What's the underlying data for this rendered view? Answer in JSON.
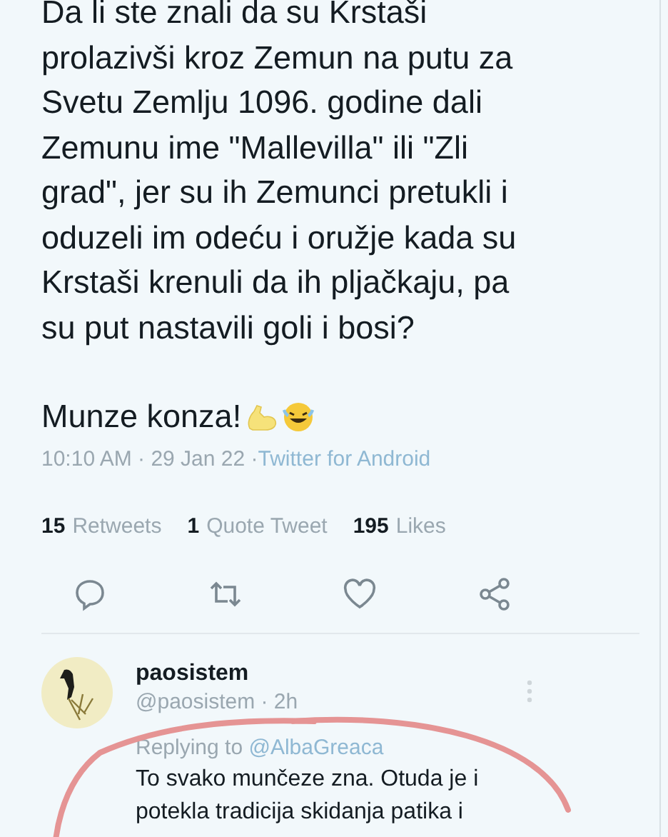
{
  "tweet": {
    "text_lines": [
      "Da li ste znali da su Krstaši",
      "prolazivši kroz Zemun na putu za",
      "Svetu Zemlju 1096. godine dali",
      "Zemunu ime \"Mallevilla\" ili \"Zli",
      "grad\", jer su ih Zemunci pretukli i",
      "oduzeli im odeću i oružje kada su",
      "Krstaši krenuli da ih pljačkaju, pa",
      "su put nastavili goli i bosi?"
    ],
    "closing": "Munze konza!",
    "time": "10:10 AM · 29 Jan 22 · ",
    "source": "Twitter for Android",
    "stats": [
      {
        "count": "15",
        "label": "Retweets"
      },
      {
        "count": "1",
        "label": "Quote Tweet"
      },
      {
        "count": "195",
        "label": "Likes"
      }
    ],
    "actions": [
      {
        "kind": "reply"
      },
      {
        "kind": "retweet"
      },
      {
        "kind": "like"
      },
      {
        "kind": "share"
      }
    ]
  },
  "reply": {
    "name": "paosistem",
    "handle": "@paosistem · 2h",
    "replying_prefix": "Replying to ",
    "replying_to": "@AlbaGreaca",
    "text_lines": [
      "To svako munčeze zna. Otuda je i",
      "potekla tradicija skidanja patika i"
    ]
  }
}
